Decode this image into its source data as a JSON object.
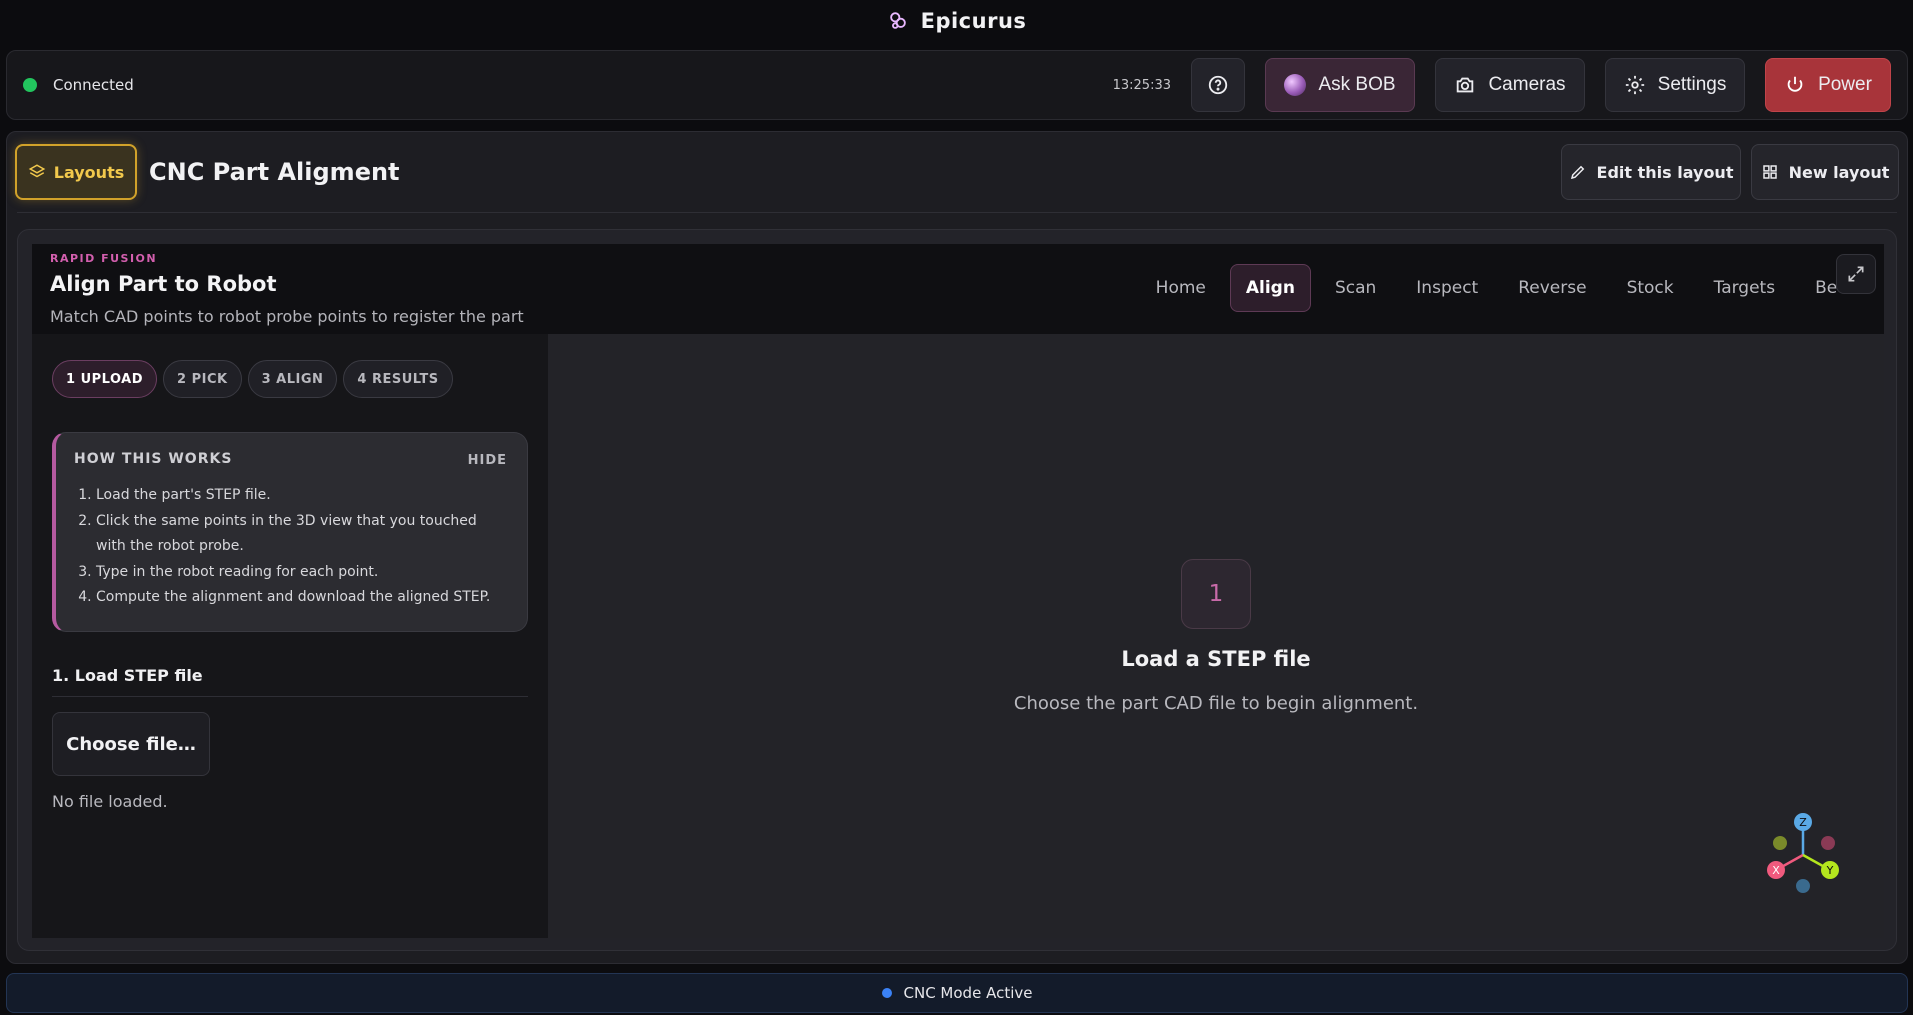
{
  "app": {
    "title": "Epicurus",
    "logo_icon": "logo-icon"
  },
  "header": {
    "status": "Connected",
    "status_color": "#22c55e",
    "time": "13:25:33",
    "ask_bob": "Ask BOB",
    "cameras": "Cameras",
    "settings": "Settings",
    "power": "Power",
    "power_color": "#a8343a"
  },
  "workspace": {
    "layouts_label": "Layouts",
    "layout_name": "CNC Part Aligment",
    "edit_label": "Edit this layout",
    "new_label": "New layout"
  },
  "module": {
    "brand": "RAPID FUSION",
    "title": "Align Part to Robot",
    "subtitle": "Match CAD points to robot probe points to register the part",
    "tabs": [
      "Home",
      "Align",
      "Scan",
      "Inspect",
      "Reverse",
      "Stock",
      "Targets",
      "Bed"
    ],
    "active_tab": "Align",
    "steps": [
      "1 UPLOAD",
      "2 PICK",
      "3 ALIGN",
      "4 RESULTS"
    ],
    "active_step": "1 UPLOAD",
    "how": {
      "title": "HOW THIS WORKS",
      "hide": "HIDE",
      "items": [
        "Load the part's STEP file.",
        "Click the same points in the 3D view that you touched with the robot probe.",
        "Type in the robot reading for each point.",
        "Compute the alignment and download the aligned STEP."
      ]
    },
    "load_title": "1. Load STEP file",
    "choose_btn": "Choose file…",
    "file_status": "No file loaded.",
    "viewer": {
      "step_number": "1",
      "title": "Load a STEP file",
      "subtitle": "Choose the part CAD file to begin alignment.",
      "axes": {
        "x": "X",
        "y": "Y",
        "z": "Z"
      }
    }
  },
  "footer": {
    "mode": "CNC Mode Active",
    "mode_color": "#3b82f6"
  }
}
